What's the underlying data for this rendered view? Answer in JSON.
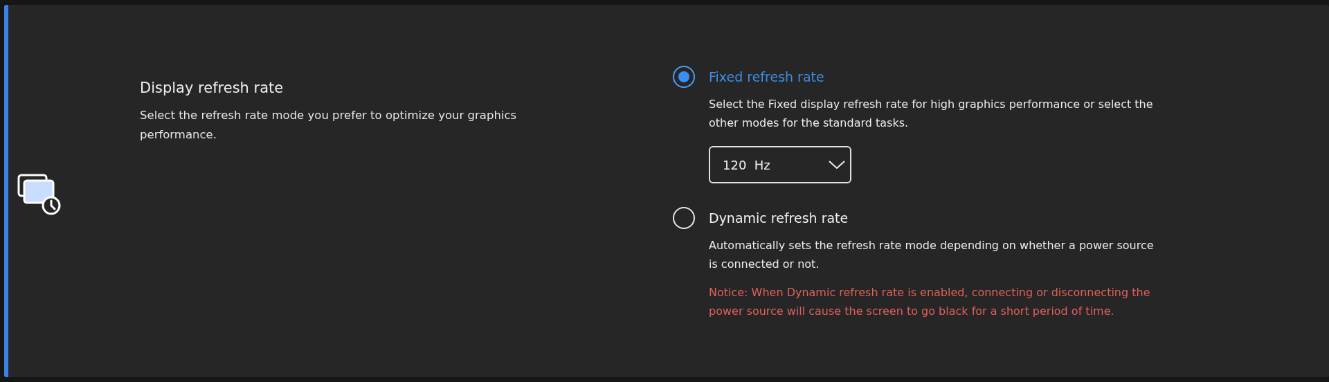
{
  "setting": {
    "title": "Display refresh rate",
    "description": "Select the refresh rate mode you prefer to optimize your graphics performance.",
    "options": [
      {
        "label": "Fixed refresh rate",
        "selected": true,
        "description": "Select the Fixed display refresh rate for high graphics performance or select the other modes for the standard tasks.",
        "dropdown": {
          "value": "120  Hz"
        }
      },
      {
        "label": "Dynamic refresh rate",
        "selected": false,
        "description": "Automatically sets the refresh rate mode depending on whether a power source is connected or not.",
        "notice": "Notice: When Dynamic refresh rate is enabled, connecting or disconnecting the power source will cause the screen to go black for a short period of time."
      }
    ]
  }
}
